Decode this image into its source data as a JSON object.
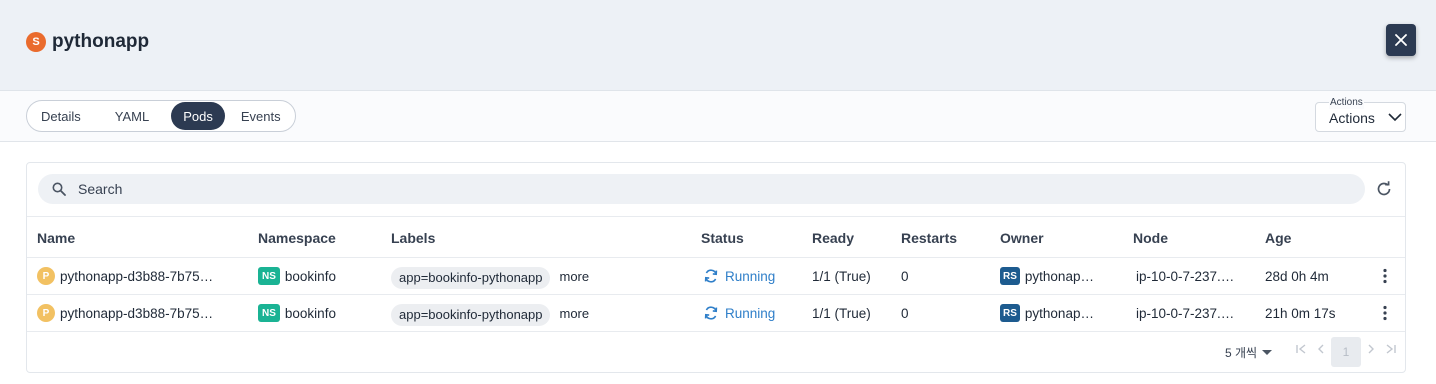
{
  "header": {
    "badge": "S",
    "title": "pythonapp",
    "close_icon": "close-icon"
  },
  "tabs": [
    {
      "label": "Details",
      "active": false
    },
    {
      "label": "YAML",
      "active": false
    },
    {
      "label": "Pods",
      "active": true
    },
    {
      "label": "Events",
      "active": false
    }
  ],
  "actions": {
    "caption": "Actions",
    "label": "Actions"
  },
  "search": {
    "placeholder": "Search"
  },
  "table": {
    "columns": [
      "Name",
      "Namespace",
      "Labels",
      "Status",
      "Ready",
      "Restarts",
      "Owner",
      "Node",
      "Age"
    ],
    "rows": [
      {
        "name_badge": "P",
        "name": "pythonapp-d3b88-7b75…",
        "ns_badge": "NS",
        "namespace": "bookinfo",
        "label": "app=bookinfo-pythonapp",
        "more": "more",
        "status": "Running",
        "ready": "1/1 (True)",
        "restarts": "0",
        "owner_badge": "RS",
        "owner": "pythonap…",
        "node": "ip-10-0-7-237.…",
        "age": "28d 0h 4m"
      },
      {
        "name_badge": "P",
        "name": "pythonapp-d3b88-7b75…",
        "ns_badge": "NS",
        "namespace": "bookinfo",
        "label": "app=bookinfo-pythonapp",
        "more": "more",
        "status": "Running",
        "ready": "1/1 (True)",
        "restarts": "0",
        "owner_badge": "RS",
        "owner": "pythonap…",
        "node": "ip-10-0-7-237.…",
        "age": "21h 0m 17s"
      }
    ]
  },
  "pagination": {
    "rows_per_page": "5 개씩",
    "current_page": "1"
  },
  "colors": {
    "accent": "#2c3a52",
    "service_badge": "#ea6b2d",
    "pod_badge": "#f2c162",
    "namespace_badge": "#1ab394",
    "replicaset_badge": "#1d5b8f",
    "status_running": "#2f7fc9"
  }
}
